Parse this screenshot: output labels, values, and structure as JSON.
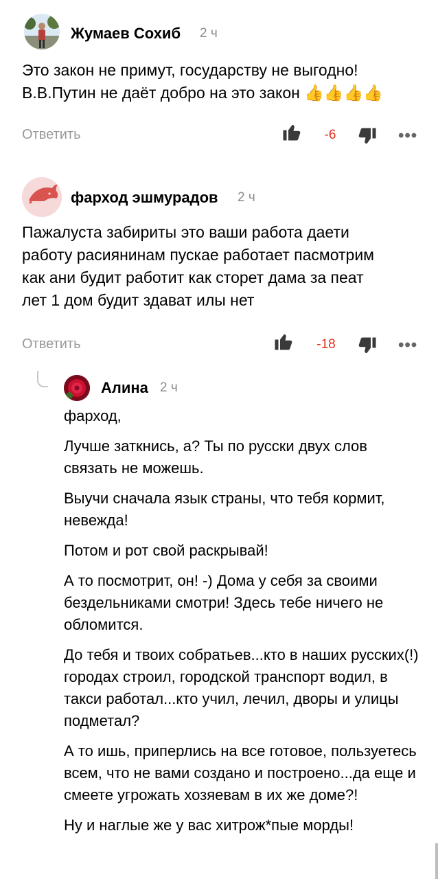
{
  "comments": [
    {
      "author": "Жумаев Сохиб",
      "time": "2 ч",
      "text_lines": [
        "Это закон не примут, государству не выгодно!",
        "В.В.Путин не даёт добро на это закон"
      ],
      "emoji": "👍👍👍👍",
      "reply_label": "Ответить",
      "score": "-6",
      "avatar_icon": "person-photo-avatar"
    },
    {
      "author": "фарход эшмурадов",
      "time": "2 ч",
      "text_lines": [
        "Пажалуста забириты это ваши работа даети",
        "работу расиянинам пускае работает пасмотрим",
        "как ани будит работит как сторет дама за пеат",
        "лет 1 дом будит здават илы нет"
      ],
      "reply_label": "Ответить",
      "score": "-18",
      "avatar_icon": "dolphin-avatar"
    }
  ],
  "reply": {
    "author": "Алина",
    "time": "2 ч",
    "paragraphs": [
      "фарход,",
      "Лучше заткнись, а? Ты по русски двух слов связать не можешь.",
      "Выучи сначала язык страны, что тебя кормит, невежда!",
      "Потом и рот свой раскрывай!",
      "А то посмотрит, он! -) Дома у себя за своими бездельниками смотри! Здесь тебе ничего не обломится.",
      "До тебя и твоих собратьев...кто в наших русских(!) городах строил, городской транспорт водил, в такси работал...кто учил, лечил, дворы и улицы подметал?",
      "А то ишь, приперлись на все готовое, пользуетесь всем, что не вами создано и построено...да еще и смеете угрожать хозяевам в их же доме?!",
      "Ну и наглые же у вас хитрож*пые морды!"
    ],
    "avatar_icon": "flower-photo-avatar"
  },
  "more_label": "•••",
  "colors": {
    "score_negative": "#e0301e",
    "muted": "#999999",
    "avatar_dolphin_bg": "#f6dada",
    "avatar_dolphin_fg": "#d9534f"
  }
}
